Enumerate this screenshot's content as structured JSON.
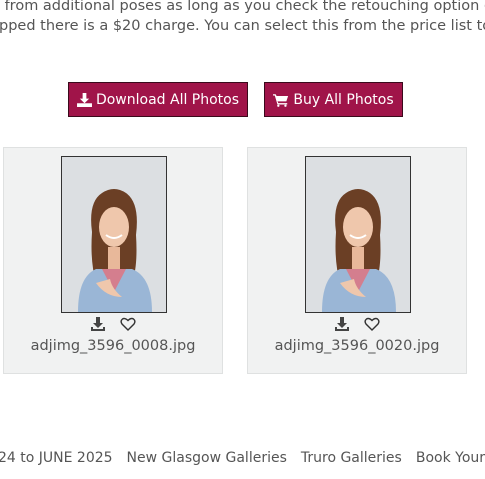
{
  "intro": {
    "line1": "r from additional poses as long as you check the retouching option on",
    "line2": "ipped there is a $20 charge. You can select this from the price list to ap"
  },
  "buttons": {
    "download_all": "Download All Photos",
    "buy_all": "Buy All Photos"
  },
  "photos": [
    {
      "filename": "adjimg_3596_0008.jpg"
    },
    {
      "filename": "adjimg_3596_0020.jpg"
    }
  ],
  "footer": {
    "links": [
      "24 to JUNE 2025",
      "New Glasgow Galleries",
      "Truro Galleries",
      "Book Your Gr"
    ]
  },
  "colors": {
    "accent": "#a01449",
    "card_bg": "#f1f2f2",
    "text": "#555555"
  },
  "icons": {
    "download": "download-icon",
    "cart": "cart-icon",
    "heart": "heart-icon"
  }
}
